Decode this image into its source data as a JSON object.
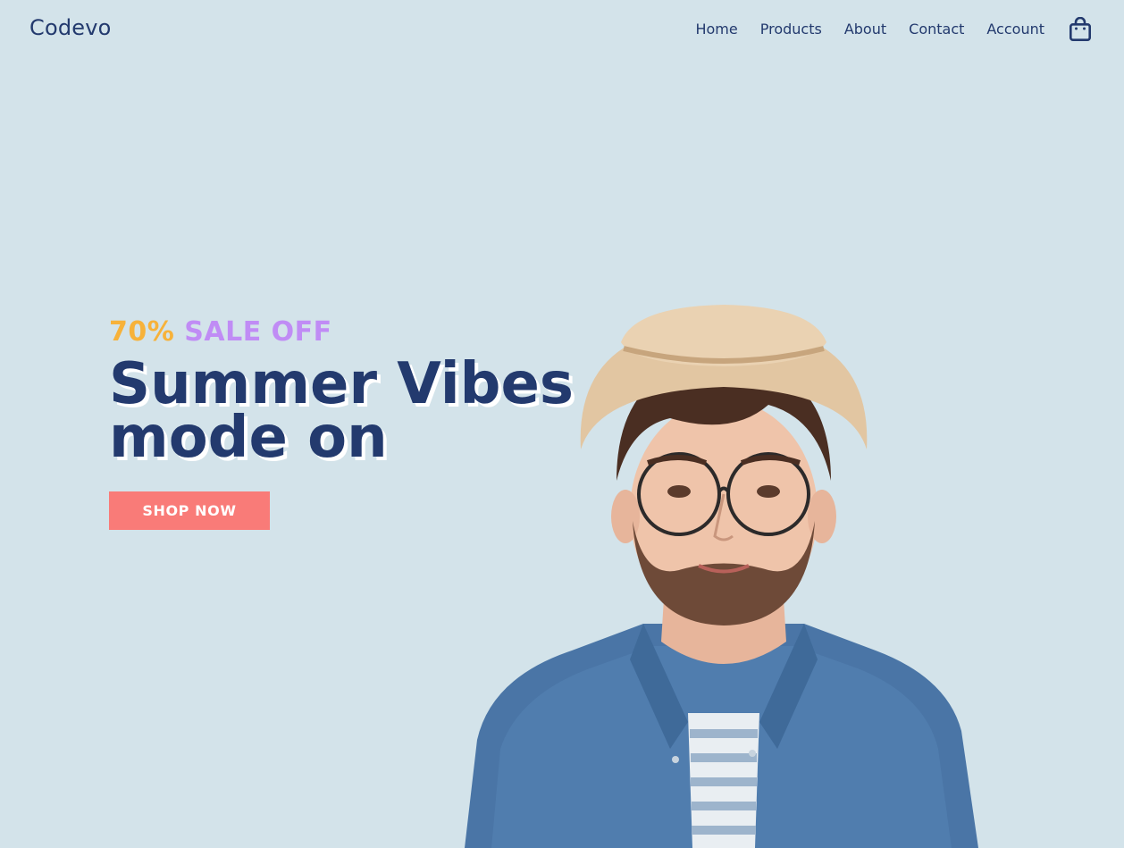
{
  "brand": {
    "name": "Codevo"
  },
  "nav": {
    "items": [
      {
        "label": "Home"
      },
      {
        "label": "Products"
      },
      {
        "label": "About"
      },
      {
        "label": "Contact"
      },
      {
        "label": "Account"
      }
    ],
    "cart_icon": "shopping-bag-icon"
  },
  "hero": {
    "sale_percent": "70%",
    "sale_text": "SALE OFF",
    "headline_line1": "Summer Vibes",
    "headline_line2": "mode on",
    "cta_label": "SHOP NOW",
    "image": "man-in-straw-hat-and-denim-shirt"
  },
  "colors": {
    "background": "#d3e3ea",
    "navy": "#233a6e",
    "orange": "#f7b23a",
    "purple": "#c08cf5",
    "cta": "#f97b78"
  }
}
